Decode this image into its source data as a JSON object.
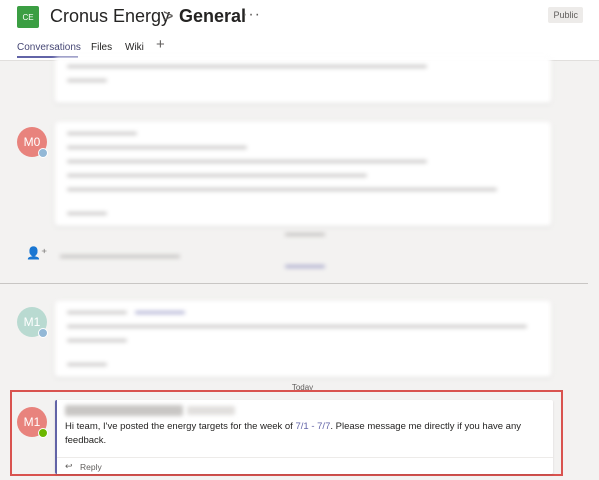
{
  "header": {
    "team_initials": "CE",
    "team_name": "Cronus Energy",
    "chevron": ">",
    "channel_name": "General",
    "more": "···",
    "visibility": "Public"
  },
  "tabs": [
    {
      "label": "Conversations",
      "active": true
    },
    {
      "label": "Files",
      "active": false
    },
    {
      "label": "Wiki",
      "active": false
    }
  ],
  "add_tab_glyph": "+",
  "threads": [
    {
      "avatar_initials": "M0",
      "avatar_color": "#e8837d",
      "status": "away"
    },
    {
      "avatar_initials": "M1",
      "avatar_color": "#b9dad1",
      "status": "away"
    }
  ],
  "today_label": "Today",
  "message": {
    "avatar_initials": "M1",
    "avatar_color": "#e8837d",
    "status": "available",
    "text_before": "Hi team, I've posted the energy targets for the week of ",
    "date_start": "7/1",
    "date_sep": " - ",
    "date_end": "7/7",
    "text_after": ". Please message me directly if you have any feedback.",
    "reply_icon": "↩",
    "reply_label": "Reply"
  },
  "colors": {
    "accent": "#6264a7",
    "highlight_border": "#d9534f",
    "team_tile": "#3b9e43",
    "status_available": "#6bb700"
  }
}
